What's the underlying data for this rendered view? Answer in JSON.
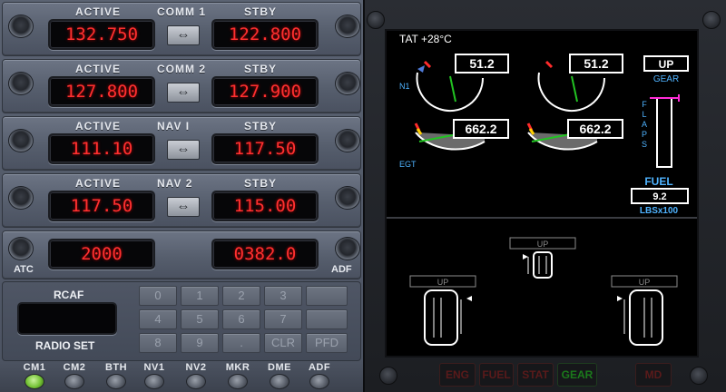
{
  "radios": [
    {
      "id": "comm1",
      "label_active": "ACTIVE",
      "label_mid": "COMM 1",
      "label_stby": "STBY",
      "active": "132.750",
      "standby": "122.800",
      "swap_icon": "swap-arrows-icon"
    },
    {
      "id": "comm2",
      "label_active": "ACTIVE",
      "label_mid": "COMM 2",
      "label_stby": "STBY",
      "active": "127.800",
      "standby": "127.900",
      "swap_icon": "swap-arrows-icon"
    },
    {
      "id": "nav1",
      "label_active": "ACTIVE",
      "label_mid": "NAV I",
      "label_stby": "STBY",
      "active": "111.10",
      "standby": "117.50",
      "swap_icon": "swap-arrows-icon"
    },
    {
      "id": "nav2",
      "label_active": "ACTIVE",
      "label_mid": "NAV 2",
      "label_stby": "STBY",
      "active": "117.50",
      "standby": "115.00",
      "swap_icon": "swap-arrows-icon"
    }
  ],
  "atc_adf": {
    "atc_label": "ATC",
    "adf_label": "ADF",
    "atc_code": "2000",
    "adf_freq": "0382.0"
  },
  "radio_set": {
    "title": "RCAF",
    "subtitle": "RADIO SET",
    "keys": [
      "0",
      "1",
      "2",
      "3",
      "",
      "4",
      "5",
      "6",
      "7",
      "",
      "8",
      "9",
      ".",
      "CLR",
      "PFD"
    ]
  },
  "selectors": [
    {
      "label": "CM1",
      "on": true
    },
    {
      "label": "CM2",
      "on": false
    },
    {
      "label": "BTH",
      "on": false
    },
    {
      "label": "NV1",
      "on": false
    },
    {
      "label": "NV2",
      "on": false
    },
    {
      "label": "MKR",
      "on": false
    },
    {
      "label": "DME",
      "on": false
    },
    {
      "label": "ADF",
      "on": false
    }
  ],
  "eicas": {
    "tat": "TAT +28°C",
    "n1_label": "N1",
    "egt_label": "EGT",
    "n1_left": "51.2",
    "n1_right": "51.2",
    "egt_left": "662.2",
    "egt_right": "662.2",
    "gear_status": "UP",
    "gear_label": "GEAR",
    "flaps_label": "FLAPS",
    "fuel_label": "FUEL",
    "fuel_value": "9.2",
    "fuel_unit": "LBSx100",
    "nose_gear": "UP",
    "left_gear": "UP",
    "right_gear": "UP"
  },
  "tabs": [
    {
      "label": "ENG",
      "selected": false
    },
    {
      "label": "FUEL",
      "selected": false
    },
    {
      "label": "STAT",
      "selected": false
    },
    {
      "label": "GEAR",
      "selected": true
    },
    {
      "label": "MD",
      "selected": false
    }
  ],
  "colors": {
    "lcd_red": "#ff3030",
    "eicas_white": "#ffffff",
    "eicas_cyan": "#4fb3ff",
    "eicas_green": "#22c322",
    "eicas_magenta": "#ff2bd6"
  }
}
